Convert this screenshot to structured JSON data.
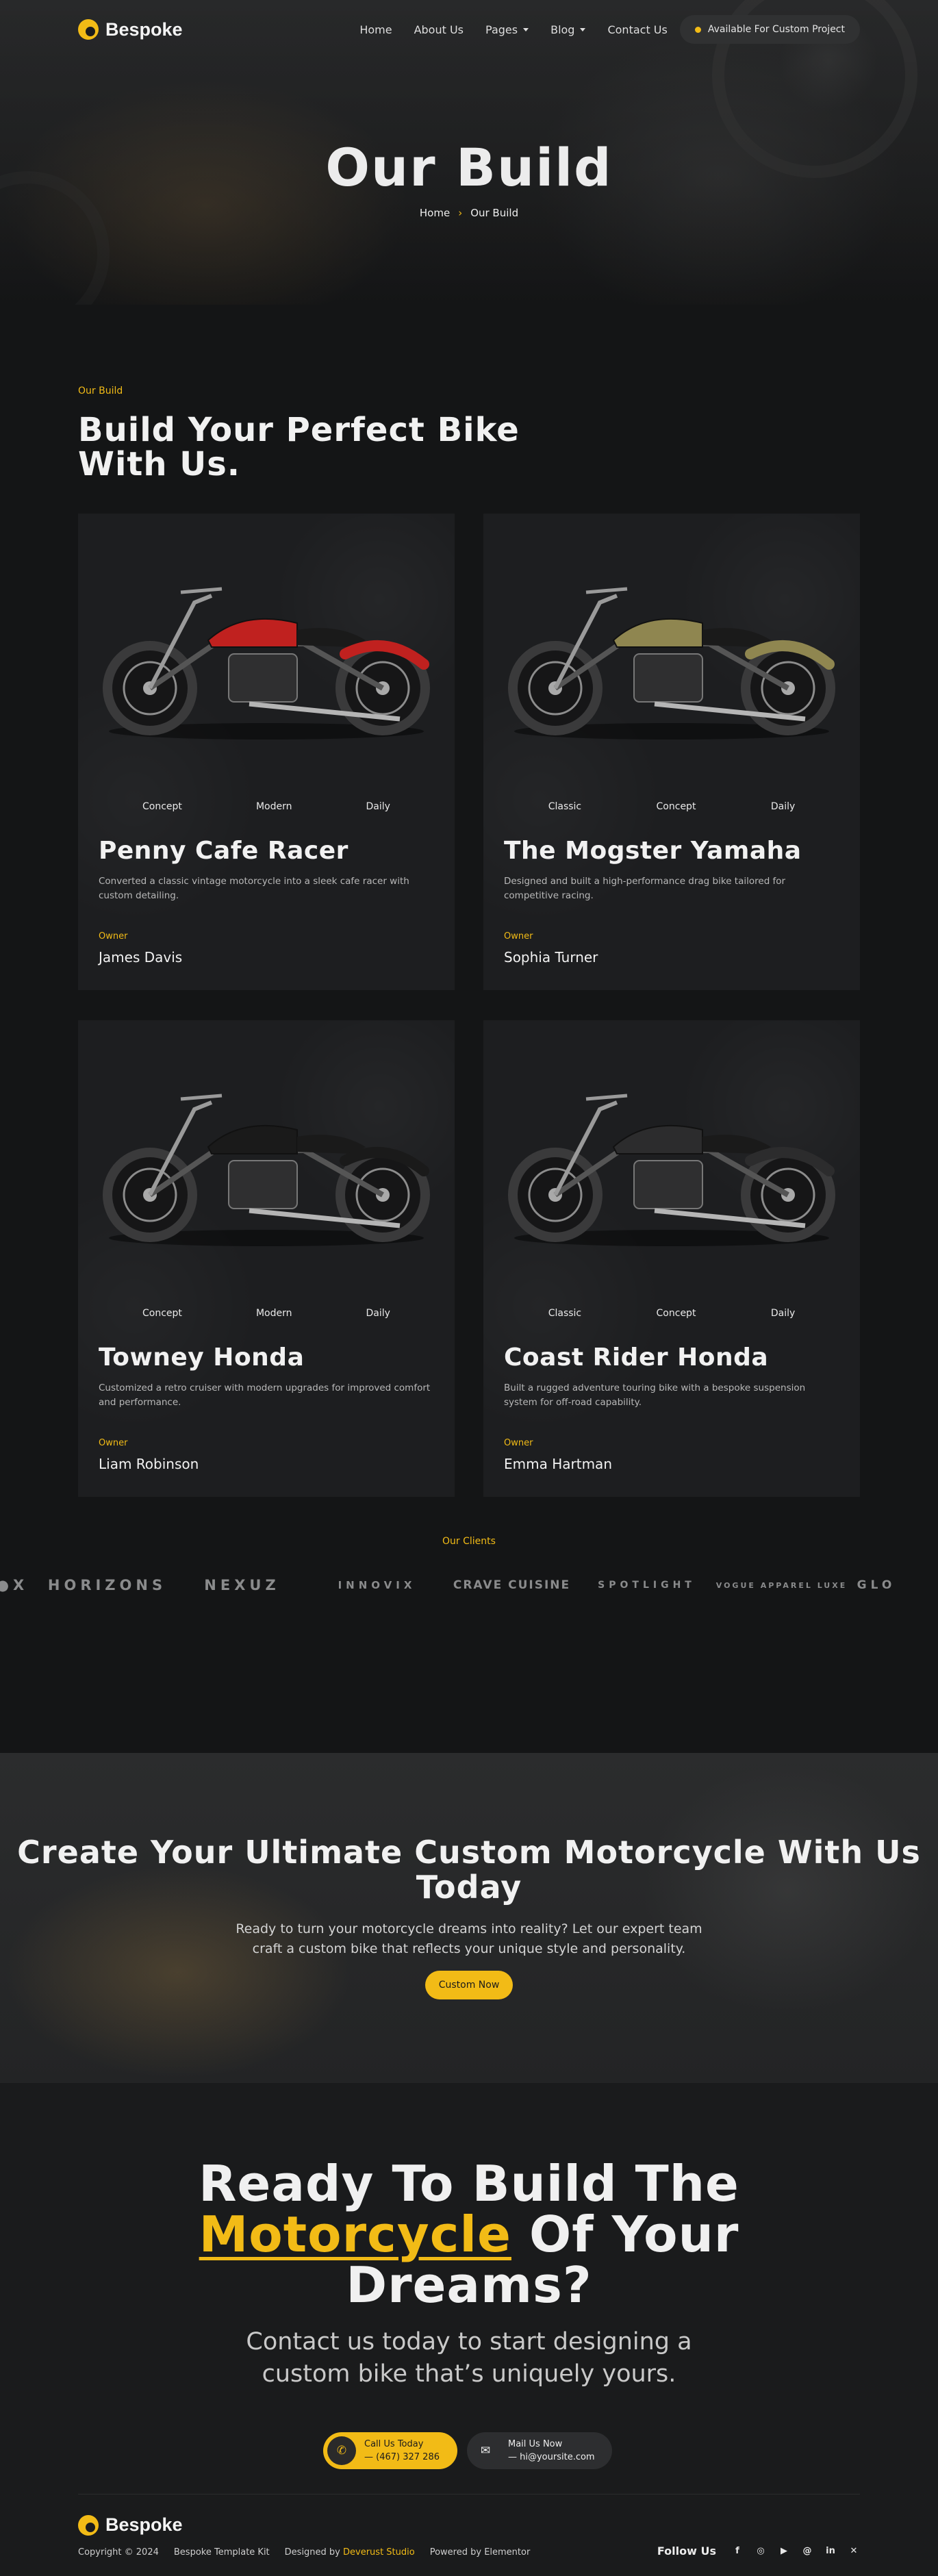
{
  "header": {
    "brand": "Bespoke",
    "nav": [
      "Home",
      "About Us",
      "Pages",
      "Blog",
      "Contact Us"
    ],
    "availability": "Available For Custom Project",
    "title": "Our Build",
    "breadcrumb": [
      "Home",
      "Our Build"
    ]
  },
  "builds": {
    "eyebrow": "Our Build",
    "title": "Build Your Perfect Bike With Us.",
    "owner_label": "Owner",
    "cards": [
      {
        "tags": [
          "Concept",
          "Modern",
          "Daily"
        ],
        "title": "Penny Cafe Racer",
        "desc": "Converted a classic vintage motorcycle into a sleek cafe racer with custom detailing.",
        "owner": "James Davis",
        "color": "#c0211f"
      },
      {
        "tags": [
          "Classic",
          "Concept",
          "Daily"
        ],
        "title": "The Mogster Yamaha",
        "desc": "Designed and built a high-performance drag bike tailored for competitive racing.",
        "owner": "Sophia Turner",
        "color": "#8f8650"
      },
      {
        "tags": [
          "Concept",
          "Modern",
          "Daily"
        ],
        "title": "Towney Honda",
        "desc": "Customized a retro cruiser with modern upgrades for improved comfort and performance.",
        "owner": "Liam Robinson",
        "color": "#1a1a1a"
      },
      {
        "tags": [
          "Classic",
          "Concept",
          "Daily"
        ],
        "title": "Coast Rider Honda",
        "desc": "Built a rugged adventure touring bike with a bespoke suspension system for off-road capability.",
        "owner": "Emma Hartman",
        "color": "#2c2c2d"
      }
    ]
  },
  "clients": {
    "title": "Our Clients",
    "logos": [
      "●X",
      "HORIZONS",
      "NEXUZ",
      "INNOVIX",
      "CRAVE CUISINE",
      "SPOTLIGHT",
      "VOGUE APPAREL LUXE",
      "GLO"
    ]
  },
  "cta": {
    "title": "Create Your Ultimate Custom Motorcycle With Us Today",
    "text": "Ready to turn your motorcycle dreams into reality? Let our expert team craft a custom bike that reflects your unique style and personality.",
    "button": "Custom Now"
  },
  "final": {
    "title_line1": "Ready To Build The",
    "title_highlight": "Motorcycle",
    "title_rest": "Of Your",
    "title_line3": "Dreams?",
    "text": "Contact us today to start designing a custom bike that’s uniquely yours.",
    "call_label": "Call Us Today",
    "call_value": "— (467) 327 286",
    "mail_label": "Mail Us Now",
    "mail_value": "— hi@yoursite.com"
  },
  "footer": {
    "brand": "Bespoke",
    "copyright": "Copyright © 2024",
    "kit": "Bespoke Template Kit",
    "designed_prefix": "Designed by",
    "designer": "Deverust Studio",
    "powered": "Powered by Elementor",
    "follow": "Follow Us",
    "socials": [
      "facebook-icon",
      "instagram-icon",
      "youtube-icon",
      "threads-icon",
      "linkedin-icon",
      "x-icon"
    ]
  },
  "colors": {
    "accent": "#f2bb16",
    "bg": "#141516",
    "card": "#1d1e20"
  }
}
